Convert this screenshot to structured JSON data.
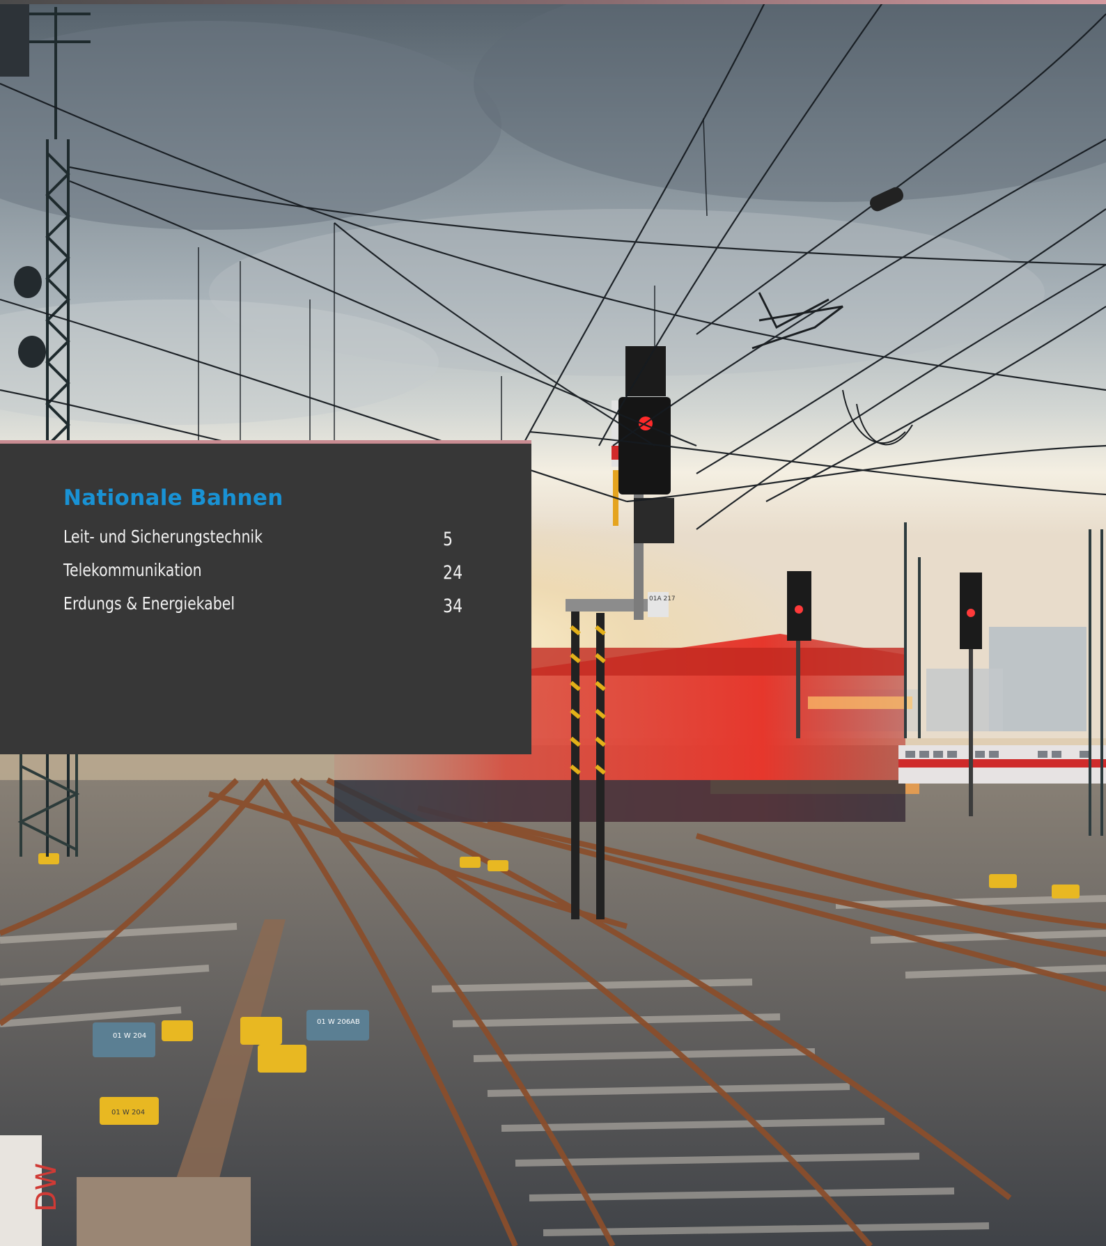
{
  "toc": {
    "section_title": "Nationale Bahnen",
    "entries": [
      {
        "label": "Leit- und Sicherungstechnik",
        "page": "5"
      },
      {
        "label": "Telekommunikation",
        "page": "24"
      },
      {
        "label": "Erdungs & Energiekabel",
        "page": "34"
      }
    ]
  },
  "photo": {
    "signal_plate_text": "01A 217",
    "box_label_1": "01 W 204",
    "box_label_2": "01 W 206AB",
    "box_label_3": "01 W 204",
    "post_marking": "DW"
  },
  "colors": {
    "title_accent": "#1992d4",
    "panel_background": "#373737",
    "panel_text": "#f2f2f2",
    "rule_accent": "#c98c92"
  }
}
